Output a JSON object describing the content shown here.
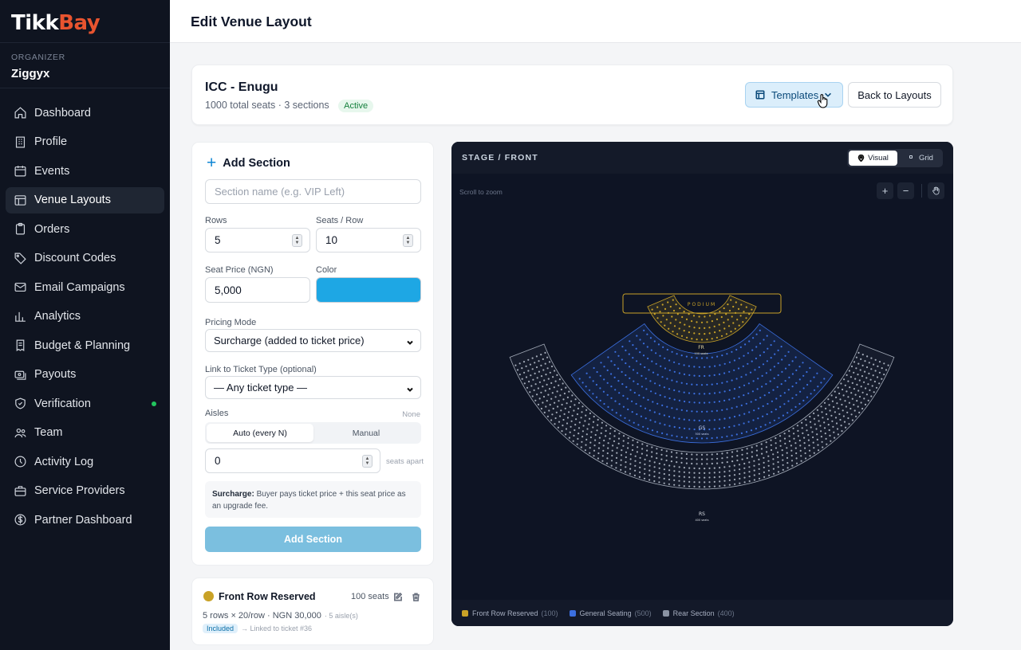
{
  "brand": {
    "name_part1": "Tikk",
    "name_part2": "Bay"
  },
  "org": {
    "label": "ORGANIZER",
    "name": "Ziggyx"
  },
  "sidebar": {
    "items": [
      {
        "label": "Dashboard",
        "icon": "home-icon"
      },
      {
        "label": "Profile",
        "icon": "building-icon"
      },
      {
        "label": "Events",
        "icon": "calendar-icon"
      },
      {
        "label": "Venue Layouts",
        "icon": "layout-icon"
      },
      {
        "label": "Orders",
        "icon": "clipboard-icon"
      },
      {
        "label": "Discount Codes",
        "icon": "tag-icon"
      },
      {
        "label": "Email Campaigns",
        "icon": "mail-icon"
      },
      {
        "label": "Analytics",
        "icon": "bar-chart-icon"
      },
      {
        "label": "Budget & Planning",
        "icon": "receipt-icon"
      },
      {
        "label": "Payouts",
        "icon": "money-icon"
      },
      {
        "label": "Verification",
        "icon": "shield-icon"
      },
      {
        "label": "Team",
        "icon": "users-icon"
      },
      {
        "label": "Activity Log",
        "icon": "clock-icon"
      },
      {
        "label": "Service Providers",
        "icon": "briefcase-icon"
      },
      {
        "label": "Partner Dashboard",
        "icon": "dollar-icon"
      }
    ],
    "active": "Venue Layouts"
  },
  "header": {
    "title": "Edit Venue Layout"
  },
  "venue": {
    "name": "ICC - Enugu",
    "meta": "1000 total seats · 3 sections",
    "status": "Active",
    "templates_label": "Templates",
    "back_label": "Back to Layouts"
  },
  "form": {
    "title": "Add Section",
    "name_placeholder": "Section name (e.g. VIP Left)",
    "rows_label": "Rows",
    "rows_value": "5",
    "seats_label": "Seats / Row",
    "seats_value": "10",
    "price_label": "Seat Price (NGN)",
    "price_value": "5,000",
    "color_label": "Color",
    "color_value": "#1ea7e4",
    "pricing_label": "Pricing Mode",
    "pricing_value": "Surcharge (added to ticket price)",
    "link_label": "Link to Ticket Type (optional)",
    "link_value": "— Any ticket type —",
    "aisles_label": "Aisles",
    "aisles_status": "None",
    "aisle_auto": "Auto (every N)",
    "aisle_manual": "Manual",
    "aisle_value": "0",
    "seats_apart": "seats apart",
    "note_bold": "Surcharge:",
    "note_text": " Buyer pays ticket price + this seat price as an upgrade fee.",
    "submit": "Add Section"
  },
  "section_list": [
    {
      "name": "Front Row Reserved",
      "seats": "100 seats",
      "detail": "5 rows × 20/row · NGN 30,000",
      "aisles": "· 5 aisle(s)",
      "badge": "Included",
      "link": "→ Linked to ticket #36",
      "color": "#c9a227"
    }
  ],
  "canvas": {
    "stage_label": "STAGE / FRONT",
    "view_visual": "Visual",
    "view_grid": "Grid",
    "zoom_hint": "Scroll to zoom",
    "zoom_in": "+",
    "zoom_out": "−",
    "podium_label": "PODIUM",
    "sections": [
      {
        "abbr": "FR",
        "seats_text": "100 seats",
        "color": "#c9a227"
      },
      {
        "abbr": "GS",
        "seats_text": "500 seats",
        "color": "#3b6fe0"
      },
      {
        "abbr": "RS",
        "seats_text": "400 seats",
        "color": "#a3abb8"
      }
    ],
    "legend": [
      {
        "name": "Front Row Reserved",
        "count": "(100)",
        "color": "#c9a227"
      },
      {
        "name": "General Seating",
        "count": "(500)",
        "color": "#3b6fe0"
      },
      {
        "name": "Rear Section",
        "count": "(400)",
        "color": "#8a93a3"
      }
    ]
  }
}
